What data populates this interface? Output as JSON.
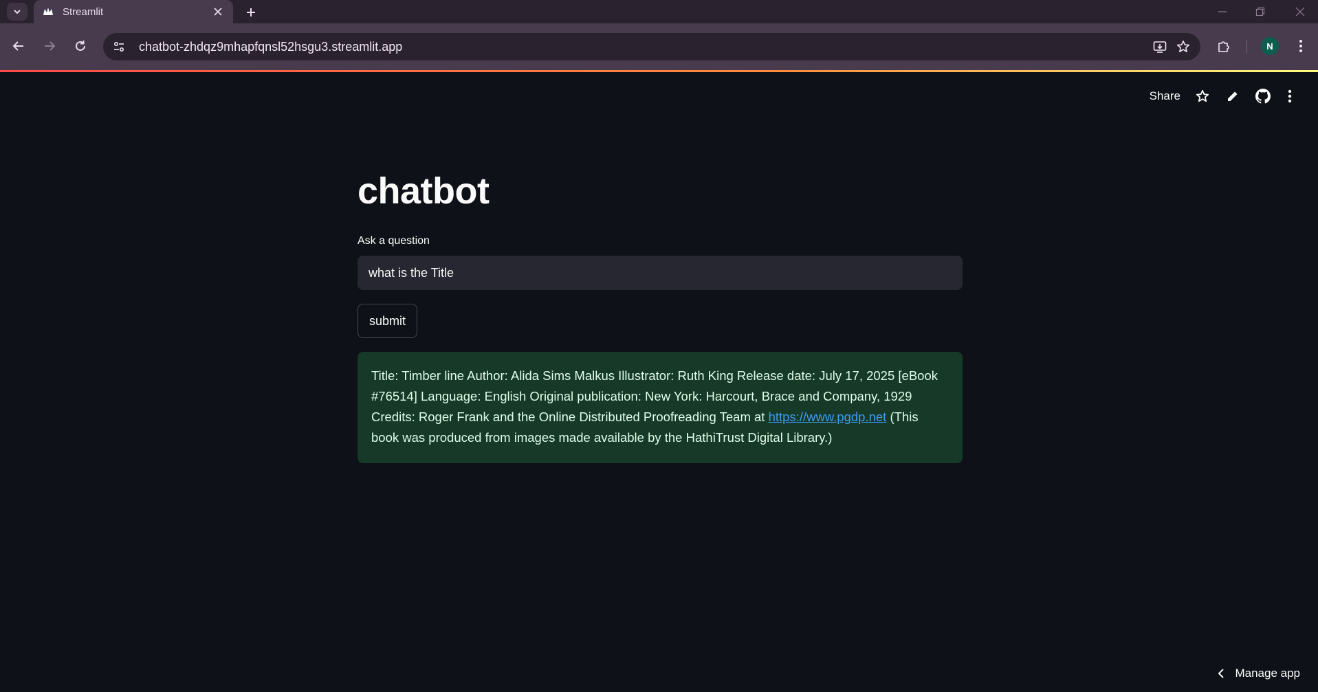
{
  "browser": {
    "tab_title": "Streamlit",
    "url": "chatbot-zhdqz9mhapfqnsl52hsgu3.streamlit.app",
    "profile_initial": "N"
  },
  "app_header": {
    "share_label": "Share"
  },
  "main": {
    "title": "chatbot",
    "input_label": "Ask a question",
    "input_value": "what is the Title",
    "submit_label": "submit",
    "answer_before_link": "Title: Timber line Author: Alida Sims Malkus Illustrator: Ruth King Release date: July 17, 2025 [eBook #76514] Language: English Original publication: New York: Harcourt, Brace and Company, 1929 Credits: Roger Frank and the Online Distributed Proofreading Team at",
    "answer_link": "https://www.pgdp.net",
    "answer_after_link": "(This book was produced from images made available by the HathiTrust Digital Library.)"
  },
  "footer": {
    "manage_label": "Manage app"
  },
  "colors": {
    "background": "#0e1117",
    "success_bg": "#173928",
    "link": "#3d9df3",
    "accent_bar_start": "#ff4b4b"
  }
}
